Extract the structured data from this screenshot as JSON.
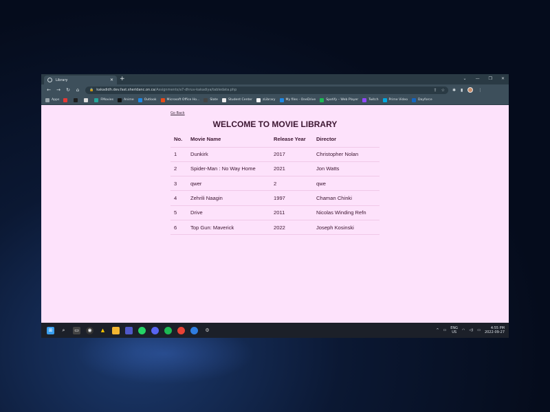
{
  "browser": {
    "tab_title": "Library",
    "new_tab": "+",
    "url_host": "kakadidh.dev.fast.sheridanc.on.ca",
    "url_path": "/Assignments/a7-dhruv-kakadiya/tabledata.php",
    "bookmarks": [
      {
        "label": "Apps",
        "color": "#9aa6ac"
      },
      {
        "label": "",
        "color": "#e53935"
      },
      {
        "label": "",
        "color": "#1e1e1e"
      },
      {
        "label": "",
        "color": "#dddddd"
      },
      {
        "label": "FMovies",
        "color": "#26a69a"
      },
      {
        "label": "Anime",
        "color": "#111111"
      },
      {
        "label": "Outlook",
        "color": "#1e88e5"
      },
      {
        "label": "Microsoft Office Ho...",
        "color": "#e64a19"
      },
      {
        "label": "Slate",
        "color": "#444444"
      },
      {
        "label": "Student Center",
        "color": "#eeeeee"
      },
      {
        "label": "zLibrary",
        "color": "#f5f5f5"
      },
      {
        "label": "My files - OneDrive",
        "color": "#1e88e5"
      },
      {
        "label": "Spotify – Web Player",
        "color": "#1db954"
      },
      {
        "label": "Twitch",
        "color": "#9146ff"
      },
      {
        "label": "Prime Video",
        "color": "#00a8e1"
      },
      {
        "label": "Dayforce",
        "color": "#1565c0"
      }
    ]
  },
  "page": {
    "go_back": "Go Back",
    "title": "WELCOME TO MOVIE LIBRARY",
    "columns": [
      "No.",
      "Movie Name",
      "Release Year",
      "Director"
    ],
    "rows": [
      [
        "1",
        "Dunkirk",
        "2017",
        "Christopher Nolan"
      ],
      [
        "2",
        "Spider-Man : No Way Home",
        "2021",
        "Jon Watts"
      ],
      [
        "3",
        "qwer",
        "2",
        "qwe"
      ],
      [
        "4",
        "Zehrili Naagin",
        "1997",
        "Chaman Chinki"
      ],
      [
        "5",
        "Drive",
        "2011",
        "Nicolas Winding Refn"
      ],
      [
        "6",
        "Top Gun: Maverick",
        "2022",
        "Joseph Kosinski"
      ]
    ]
  },
  "taskbar": {
    "lang_top": "ENG",
    "lang_bottom": "US",
    "time": "4:55 PM",
    "date": "2022-09-27"
  }
}
